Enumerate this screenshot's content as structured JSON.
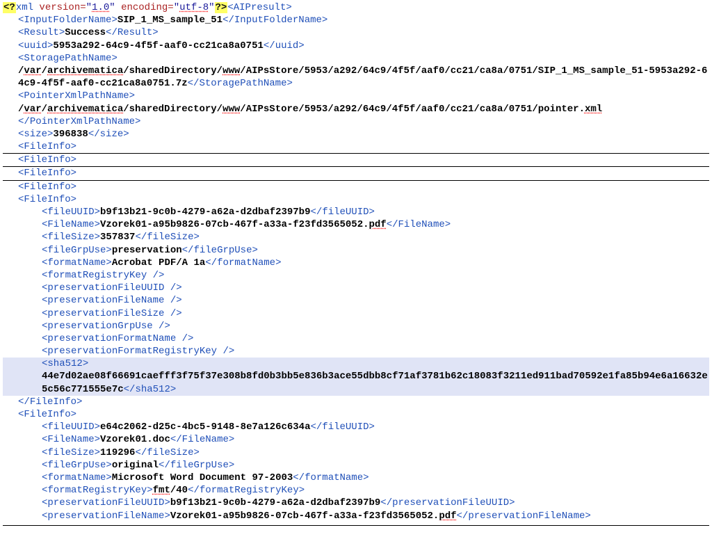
{
  "xml_decl": {
    "version": "1.0",
    "encoding": "utf-8"
  },
  "root_tag": "AIPresult",
  "header": {
    "input_folder": "SIP_1_MS_sample_51",
    "result": "Success",
    "uuid": "5953a292-64c9-4f5f-aaf0-cc21ca8a0751",
    "storage_path_pre": "/",
    "storage_path_var": "var",
    "storage_path_am": "archivematica",
    "storage_tail": "/sharedDirectory/",
    "storage_www": "www",
    "storage_rest": "/AIPsStore/5953/a292/64c9/4f5f/aaf0/cc21/ca8a/0751/SIP_1_MS_sample_51-5953a292-64c9-4f5f-aaf0-cc21ca8a0751.7z",
    "pointer_rest": "/AIPsStore/5953/a292/64c9/4f5f/aaf0/cc21/ca8a/0751/pointer.",
    "pointer_ext": "xml",
    "size": "396838"
  },
  "file1": {
    "fileUUID": "b9f13b21-9c0b-4279-a62a-d2dbaf2397b9",
    "FileName_main": "Vzorek01-a95b9826-07cb-467f-a33a-f23fd3565052.",
    "FileName_ext": "pdf",
    "fileSize": "357837",
    "fileGrpUse": "preservation",
    "formatName": "Acrobat PDF/A 1a",
    "sha512": "44e7d02ae08f66691caefff3f75f37e308b8fd0b3bb5e836b3ace55dbb8cf71af3781b62c18083f3211ed911bad70592e1fa85b94e6a16632e5c56c771555e7c"
  },
  "file2": {
    "fileUUID": "e64c2062-d25c-4bc5-9148-8e7a126c634a",
    "FileName": "Vzorek01.doc",
    "fileSize": "119296",
    "fileGrpUse": "original",
    "formatName": "Microsoft Word Document 97-2003",
    "formatRegistryKey_pre": "fmt",
    "formatRegistryKey_post": "/40",
    "preservationFileUUID": "b9f13b21-9c0b-4279-a62a-d2dbaf2397b9",
    "preservationFileName_main": "Vzorek01-a95b9826-07cb-467f-a33a-f23fd3565052.",
    "preservationFileName_ext": "pdf"
  },
  "labels": {
    "InputFolderName": "InputFolderName",
    "Result": "Result",
    "uuid": "uuid",
    "StoragePathName": "StoragePathName",
    "PointerXmlPathName": "PointerXmlPathName",
    "size": "size",
    "FileInfo": "FileInfo",
    "fileUUID": "fileUUID",
    "FileName": "FileName",
    "fileSize": "fileSize",
    "fileGrpUse": "fileGrpUse",
    "formatName": "formatName",
    "formatRegistryKey": "formatRegistryKey",
    "preservationFileUUID": "preservationFileUUID",
    "preservationFileName": "preservationFileName",
    "preservationFileSize": "preservationFileSize",
    "preservationGrpUse": "preservationGrpUse",
    "preservationFormatName": "preservationFormatName",
    "preservationFormatRegistryKey": "preservationFormatRegistryKey",
    "sha512": "sha512"
  }
}
